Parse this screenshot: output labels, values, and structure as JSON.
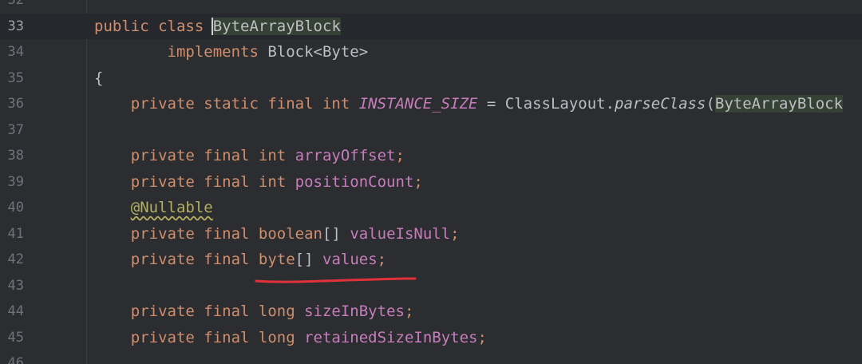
{
  "editor": {
    "lines": [
      {
        "num": "32",
        "tokens": []
      },
      {
        "num": "33",
        "current": true,
        "tokens": [
          {
            "t": "public class ",
            "c": "kw"
          },
          {
            "t": "B",
            "c": "plain hl caret-char"
          },
          {
            "t": "yteArrayBlock",
            "c": "plain hl"
          }
        ]
      },
      {
        "num": "34",
        "tokens": [
          {
            "t": "        implements ",
            "c": "kw"
          },
          {
            "t": "Block<Byte>",
            "c": "plain"
          }
        ]
      },
      {
        "num": "35",
        "tokens": [
          {
            "t": "{",
            "c": "plain"
          }
        ]
      },
      {
        "num": "36",
        "tokens": [
          {
            "t": "    private static final int ",
            "c": "kw"
          },
          {
            "t": "INSTANCE_SIZE",
            "c": "const"
          },
          {
            "t": " = ClassLayout.",
            "c": "plain"
          },
          {
            "t": "parseClass",
            "c": "method"
          },
          {
            "t": "(",
            "c": "plain"
          },
          {
            "t": "ByteArrayBlock",
            "c": "plain hl"
          }
        ]
      },
      {
        "num": "37",
        "tokens": []
      },
      {
        "num": "38",
        "tokens": [
          {
            "t": "    private final int ",
            "c": "kw"
          },
          {
            "t": "arrayOffset",
            "c": "field"
          },
          {
            "t": ";",
            "c": "kw"
          }
        ]
      },
      {
        "num": "39",
        "tokens": [
          {
            "t": "    private final int ",
            "c": "kw"
          },
          {
            "t": "positionCount",
            "c": "field"
          },
          {
            "t": ";",
            "c": "kw"
          }
        ]
      },
      {
        "num": "40",
        "tokens": [
          {
            "t": "    ",
            "c": "plain"
          },
          {
            "t": "@Nullable",
            "c": "anno anno-warn"
          }
        ]
      },
      {
        "num": "41",
        "tokens": [
          {
            "t": "    private final boolean",
            "c": "kw"
          },
          {
            "t": "[] ",
            "c": "plain"
          },
          {
            "t": "valueIsNull",
            "c": "field"
          },
          {
            "t": ";",
            "c": "kw"
          }
        ]
      },
      {
        "num": "42",
        "tokens": [
          {
            "t": "    private final byte",
            "c": "kw"
          },
          {
            "t": "[] ",
            "c": "plain"
          },
          {
            "t": "values",
            "c": "field"
          },
          {
            "t": ";",
            "c": "kw"
          }
        ]
      },
      {
        "num": "43",
        "tokens": []
      },
      {
        "num": "44",
        "tokens": [
          {
            "t": "    private final long ",
            "c": "kw"
          },
          {
            "t": "sizeInBytes",
            "c": "field"
          },
          {
            "t": ";",
            "c": "kw"
          }
        ]
      },
      {
        "num": "45",
        "tokens": [
          {
            "t": "    private final long ",
            "c": "kw"
          },
          {
            "t": "retainedSizeInBytes",
            "c": "field"
          },
          {
            "t": ";",
            "c": "kw"
          }
        ]
      },
      {
        "num": "46",
        "tokens": []
      }
    ]
  },
  "colors": {
    "background": "#2b2d30",
    "keyword": "#cf8e6d",
    "field": "#c77dbb",
    "annotation": "#b3ae60",
    "plain": "#bcbec4",
    "line_number": "#6f737a",
    "markup_underline": "#e0323a"
  }
}
